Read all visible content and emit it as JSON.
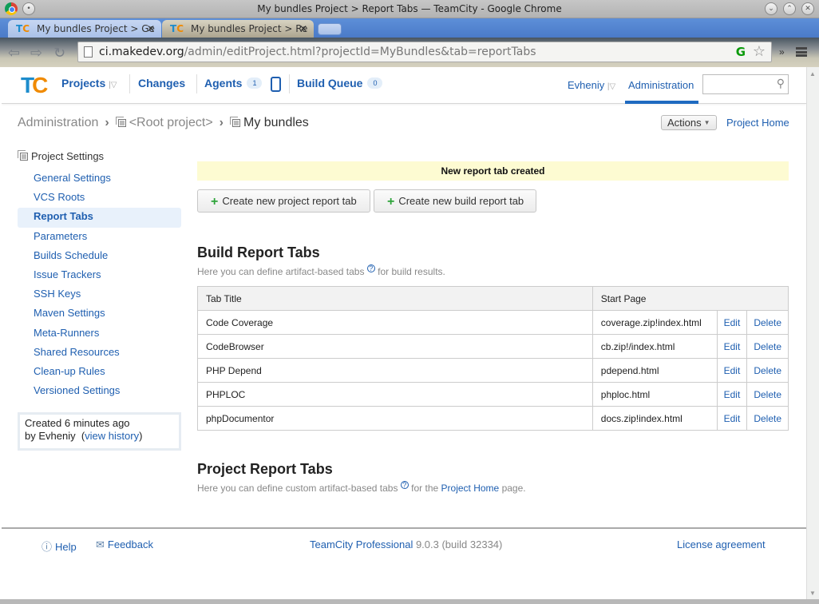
{
  "window": {
    "title": "My bundles Project > Report Tabs — TeamCity - Google Chrome",
    "controls": [
      "minimize",
      "maximize",
      "close"
    ]
  },
  "browser": {
    "tabs": [
      {
        "title": "My bundles Project > Ge",
        "active": false
      },
      {
        "title": "My bundles Project > Re",
        "active": true
      }
    ],
    "url_host": "ci.makedev.org",
    "url_path": "/admin/editProject.html?projectId=MyBundles&tab=reportTabs",
    "ext_icon": "G",
    "more": "»"
  },
  "header": {
    "logo": "TC",
    "nav": {
      "projects": "Projects",
      "changes": "Changes",
      "agents": "Agents",
      "agents_count": "1",
      "build_queue": "Build Queue",
      "build_queue_count": "0"
    },
    "user": "Evheniy",
    "administration": "Administration",
    "search_placeholder": ""
  },
  "breadcrumb": {
    "items": [
      "Administration",
      "<Root project>",
      "My bundles"
    ],
    "actions_label": "Actions",
    "project_home": "Project Home"
  },
  "sidebar": {
    "heading": "Project Settings",
    "items": [
      {
        "label": "General Settings",
        "selected": false
      },
      {
        "label": "VCS Roots",
        "selected": false
      },
      {
        "label": "Report Tabs",
        "selected": true
      },
      {
        "label": "Parameters",
        "selected": false
      },
      {
        "label": "Builds Schedule",
        "selected": false
      },
      {
        "label": "Issue Trackers",
        "selected": false
      },
      {
        "label": "SSH Keys",
        "selected": false
      },
      {
        "label": "Maven Settings",
        "selected": false
      },
      {
        "label": "Meta-Runners",
        "selected": false
      },
      {
        "label": "Shared Resources",
        "selected": false
      },
      {
        "label": "Clean-up Rules",
        "selected": false
      },
      {
        "label": "Versioned Settings",
        "selected": false
      }
    ],
    "info": {
      "created": "Created 6 minutes ago",
      "by": "by Evheniy",
      "history_link": "view history"
    }
  },
  "main": {
    "flash_message": "New report tab created",
    "create_project_tab": "Create new project report tab",
    "create_build_tab": "Create new build report tab",
    "build_section": {
      "title": "Build Report Tabs",
      "desc_before": "Here you can define artifact-based tabs",
      "desc_after": "for build results.",
      "columns": [
        "Tab Title",
        "Start Page"
      ],
      "rows": [
        {
          "title": "Code Coverage",
          "start_page": "coverage.zip!index.html",
          "edit": "Edit",
          "delete": "Delete"
        },
        {
          "title": "CodeBrowser",
          "start_page": "cb.zip!/index.html",
          "edit": "Edit",
          "delete": "Delete"
        },
        {
          "title": "PHP Depend",
          "start_page": "pdepend.html",
          "edit": "Edit",
          "delete": "Delete"
        },
        {
          "title": "PHPLOC",
          "start_page": "phploc.html",
          "edit": "Edit",
          "delete": "Delete"
        },
        {
          "title": "phpDocumentor",
          "start_page": "docs.zip!index.html",
          "edit": "Edit",
          "delete": "Delete"
        }
      ]
    },
    "project_section": {
      "title": "Project Report Tabs",
      "desc_before": "Here you can define custom artifact-based tabs",
      "desc_mid": "for the",
      "desc_link": "Project Home",
      "desc_after": "page."
    }
  },
  "footer": {
    "help": "Help",
    "feedback": "Feedback",
    "product": "TeamCity Professional",
    "version": "9.0.3 (build 32334)",
    "license": "License agreement"
  }
}
